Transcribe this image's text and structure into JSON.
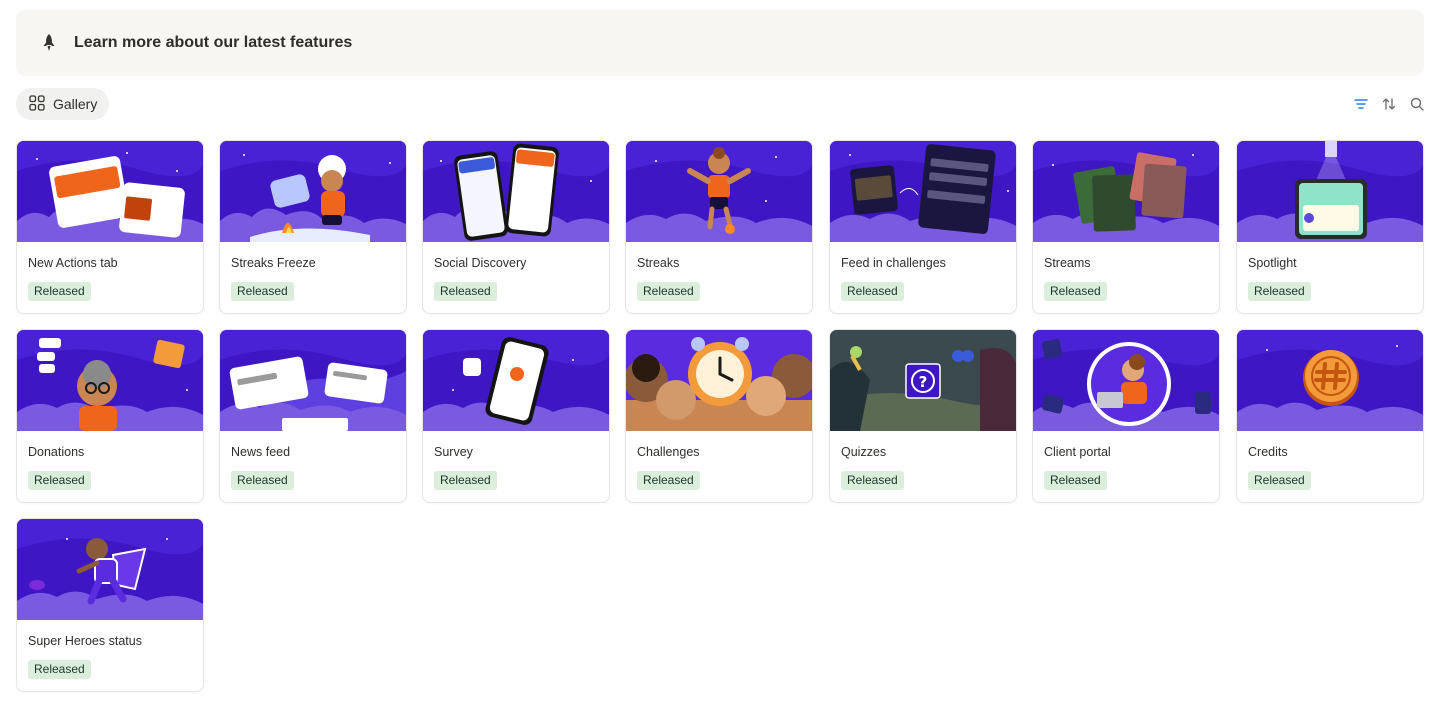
{
  "callout": {
    "title": "Learn more about our latest features",
    "icon": "rocket-icon"
  },
  "view": {
    "tab_label": "Gallery",
    "icon": "gallery-grid-icon"
  },
  "toolbar": {
    "filter_icon": "filter-icon",
    "sort_icon": "sort-icon",
    "search_icon": "search-icon",
    "accent": "#2383e2"
  },
  "status_colors": {
    "released_bg": "#dbeddb",
    "released_text": "#1c3829"
  },
  "cover_colors": {
    "sky": "#3e16c4",
    "cloud": "#7a5ae0",
    "cloud_light": "#9b7ff0"
  },
  "cards": [
    {
      "title": "New Actions tab",
      "status": "Released"
    },
    {
      "title": "Streaks Freeze",
      "status": "Released"
    },
    {
      "title": "Social Discovery",
      "status": "Released"
    },
    {
      "title": "Streaks",
      "status": "Released"
    },
    {
      "title": "Feed in challenges",
      "status": "Released"
    },
    {
      "title": "Streams",
      "status": "Released"
    },
    {
      "title": "Spotlight",
      "status": "Released"
    },
    {
      "title": "Donations",
      "status": "Released"
    },
    {
      "title": "News feed",
      "status": "Released"
    },
    {
      "title": "Survey",
      "status": "Released"
    },
    {
      "title": "Challenges",
      "status": "Released"
    },
    {
      "title": "Quizzes",
      "status": "Released"
    },
    {
      "title": "Client portal",
      "status": "Released"
    },
    {
      "title": "Credits",
      "status": "Released"
    },
    {
      "title": "Super Heroes status",
      "status": "Released"
    }
  ]
}
